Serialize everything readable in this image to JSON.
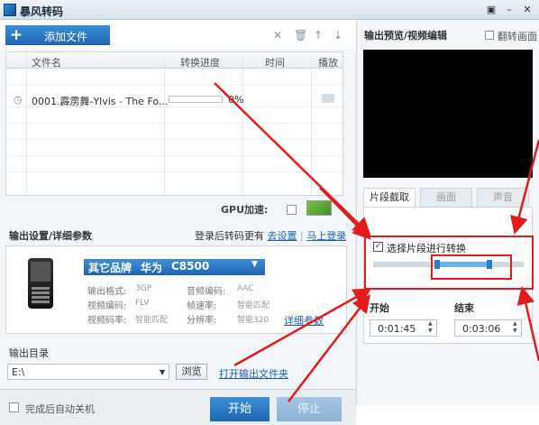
{
  "window": {
    "title": "暴风转码",
    "buttons": [
      "▣",
      "–",
      "✕"
    ]
  },
  "toolbar": {
    "add_label": "添加文件",
    "plus": "+",
    "icons": [
      "close-icon",
      "trash-icon",
      "up-arrow-icon",
      "down-arrow-icon"
    ]
  },
  "file_table": {
    "headers": [
      "文件名",
      "转换进度",
      "时间",
      "播放"
    ],
    "rows": [
      {
        "name": "0001.霹雳舞-Ylvis - The Fo...",
        "progress_text": "0%",
        "progress_value": 0,
        "time": ""
      }
    ]
  },
  "gpu": {
    "label": "GPU加速:"
  },
  "output_settings": {
    "title": "输出设置/详细参数",
    "login_text": "登录后转码更有",
    "link1": "去设置",
    "link2": "马上登录",
    "device": {
      "brand": "其它品牌",
      "maker": "华为",
      "model": "C8500"
    },
    "specs": [
      {
        "k": "输出格式:",
        "v": "3GP"
      },
      {
        "k": "音频编码:",
        "v": "AAC"
      },
      {
        "k": "视频编码:",
        "v": "FLV"
      },
      {
        "k": "帧速率:",
        "v": "智能匹配"
      },
      {
        "k": "视频码率:",
        "v": "智能匹配"
      },
      {
        "k": "分辨率:",
        "v": "智能320"
      }
    ],
    "detail_link": "详细参数"
  },
  "output_dir": {
    "title": "输出目录",
    "path": "E:\\",
    "browse": "浏览",
    "open_link": "打开输出文件夹"
  },
  "bottom": {
    "shutdown_label": "完成后自动关机",
    "start": "开始",
    "stop": "停止"
  },
  "right": {
    "title": "输出预览/视频编辑",
    "flip_label": "翻转画面",
    "tabs": [
      "片段截取",
      "画面",
      "声音"
    ],
    "clip_label": "选择片段进行转换",
    "start_label": "开始",
    "end_label": "结束",
    "start_time": "0:01:45",
    "end_time": "0:03:06"
  }
}
